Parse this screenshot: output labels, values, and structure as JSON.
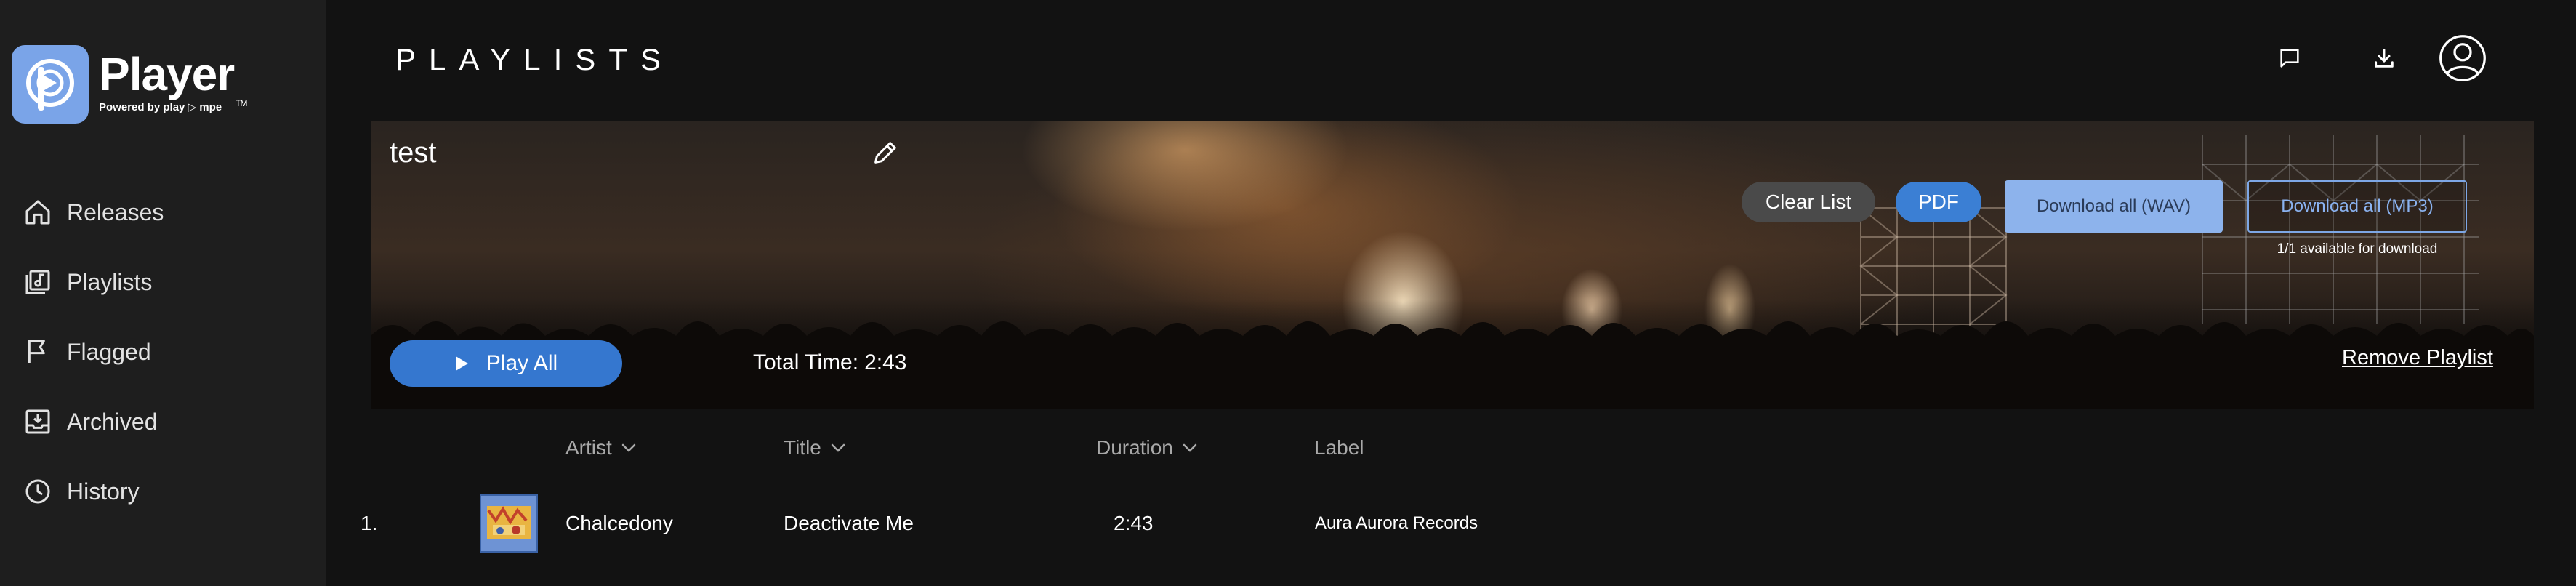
{
  "app": {
    "name": "Player",
    "trademark": "TM",
    "powered_by": "Powered by play ▷ mpe",
    "brand_color": "#7aa4e8"
  },
  "sidebar": {
    "items": [
      {
        "label": "Releases",
        "icon": "home-icon"
      },
      {
        "label": "Playlists",
        "icon": "playlist-icon"
      },
      {
        "label": "Flagged",
        "icon": "flag-icon"
      },
      {
        "label": "Archived",
        "icon": "archive-icon"
      },
      {
        "label": "History",
        "icon": "history-icon"
      }
    ]
  },
  "header": {
    "title": "PLAYLISTS",
    "icons": [
      "chat-icon",
      "download-icon",
      "user-avatar-icon"
    ]
  },
  "playlist": {
    "name": "test",
    "clear_label": "Clear List",
    "pdf_label": "PDF",
    "download_wav_label": "Download all (WAV)",
    "download_mp3_label": "Download all (MP3)",
    "available_text": "1/1 available for download",
    "play_all_label": "Play All",
    "total_time_label": "Total Time:",
    "total_time_value": "2:43",
    "remove_label": "Remove Playlist",
    "accent_color": "#3577cf"
  },
  "table": {
    "columns": [
      "Artist",
      "Title",
      "Duration",
      "Label"
    ],
    "rows": [
      {
        "index": "1.",
        "artist": "Chalcedony",
        "title": "Deactivate Me",
        "duration": "2:43",
        "label": "Aura Aurora Records"
      }
    ]
  }
}
